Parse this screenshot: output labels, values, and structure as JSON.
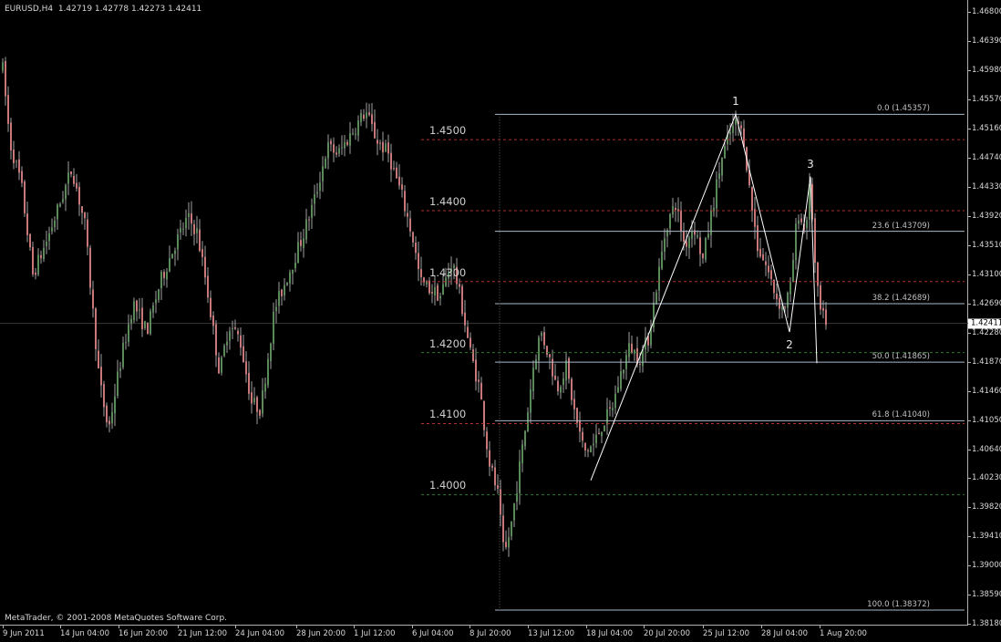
{
  "chart_header": {
    "symbol_info": "EURUSD,H4  1.42719 1.42778 1.42273 1.42411",
    "copyright": "MetaTrader, © 2001-2008 MetaQuotes Software Corp."
  },
  "colors": {
    "background": "#000000",
    "bull_candle": "#5a8a5a",
    "bear_candle": "#c87878",
    "wick": "#a0a0a0",
    "fib_line": "#a8b8c8",
    "round_level_red": "#b03030",
    "round_level_green": "#2e7a2e",
    "wave_line": "#ffffff"
  },
  "price_axis": {
    "ticks": [
      "1.46800",
      "1.46390",
      "1.45980",
      "1.45570",
      "1.45160",
      "1.44740",
      "1.44330",
      "1.43920",
      "1.43510",
      "1.43100",
      "1.42690",
      "1.42280",
      "1.41870",
      "1.41460",
      "1.41050",
      "1.40640",
      "1.40230",
      "1.39820",
      "1.39410",
      "1.39000",
      "1.38590",
      "1.38180"
    ],
    "current_price": "1.42411"
  },
  "time_axis": {
    "labels": [
      "9 Jun 2011",
      "14 Jun 04:00",
      "16 Jun 20:00",
      "21 Jun 12:00",
      "24 Jun 04:00",
      "28 Jun 20:00",
      "1 Jul 12:00",
      "6 Jul 04:00",
      "8 Jul 20:00",
      "13 Jul 12:00",
      "18 Jul 04:00",
      "20 Jul 20:00",
      "25 Jul 12:00",
      "28 Jul 04:00",
      "1 Aug 20:00"
    ]
  },
  "round_levels": [
    {
      "label": "1.4500",
      "price": 1.45,
      "color": "red"
    },
    {
      "label": "1.4400",
      "price": 1.44,
      "color": "red"
    },
    {
      "label": "1.4300",
      "price": 1.43,
      "color": "red"
    },
    {
      "label": "1.4200",
      "price": 1.42,
      "color": "green"
    },
    {
      "label": "1.4100",
      "price": 1.41,
      "color": "red"
    },
    {
      "label": "1.4000",
      "price": 1.4,
      "color": "green"
    }
  ],
  "fibonacci": [
    {
      "label": "0.0 (1.45357)",
      "price": 1.45357
    },
    {
      "label": "23.6 (1.43709)",
      "price": 1.43709
    },
    {
      "label": "38.2 (1.42689)",
      "price": 1.42689
    },
    {
      "label": "50.0 (1.41865)",
      "price": 1.41865
    },
    {
      "label": "61.8 (1.41040)",
      "price": 1.4104
    },
    {
      "label": "100.0 (1.38372)",
      "price": 1.38372
    }
  ],
  "waves": [
    {
      "label": "1",
      "price": 1.45357
    },
    {
      "label": "2",
      "price": 1.4229
    },
    {
      "label": "3",
      "price": 1.4448
    }
  ]
}
